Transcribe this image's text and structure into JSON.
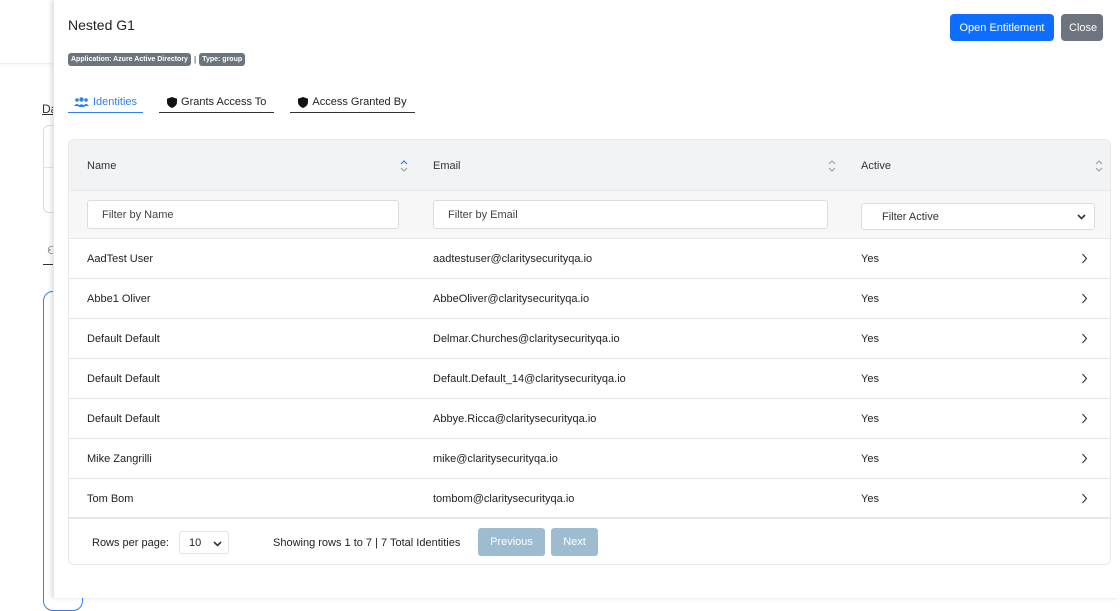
{
  "background": {
    "partial_link": "Da"
  },
  "modal": {
    "title": "Nested G1",
    "buttons": {
      "open_entitlement": "Open Entitlement",
      "close": "Close"
    },
    "badges": [
      "Application: Azure Active Directory",
      "Type: group"
    ],
    "badge_separator": "|",
    "tabs": [
      {
        "label": "Identities",
        "icon": "users-icon",
        "active": true
      },
      {
        "label": "Grants Access To",
        "icon": "shield-icon",
        "active": false
      },
      {
        "label": "Access Granted By",
        "icon": "shield-icon",
        "active": false
      }
    ],
    "accent_color": "#2f80ed"
  },
  "table": {
    "columns": [
      {
        "label": "Name",
        "sort": "ascending"
      },
      {
        "label": "Email",
        "sort": "none"
      },
      {
        "label": "Active",
        "sort": "none"
      }
    ],
    "filters": {
      "name_placeholder": "Filter by Name",
      "email_placeholder": "Filter by Email",
      "active_selected": "Filter Active"
    },
    "rows": [
      {
        "name": "AadTest User",
        "email": "aadtestuser@claritysecurityqa.io",
        "active": "Yes"
      },
      {
        "name": "Abbe1 Oliver",
        "email": "AbbeOliver@claritysecurityqa.io",
        "active": "Yes"
      },
      {
        "name": "Default Default",
        "email": "Delmar.Churches@claritysecurityqa.io",
        "active": "Yes"
      },
      {
        "name": "Default Default",
        "email": "Default.Default_14@claritysecurityqa.io",
        "active": "Yes"
      },
      {
        "name": "Default Default",
        "email": "Abbye.Ricca@claritysecurityqa.io",
        "active": "Yes"
      },
      {
        "name": "Mike Zangrilli",
        "email": "mike@claritysecurityqa.io",
        "active": "Yes"
      },
      {
        "name": "Tom Bom",
        "email": "tombom@claritysecurityqa.io",
        "active": "Yes"
      }
    ]
  },
  "pagination": {
    "rows_per_page_label": "Rows per page:",
    "rows_per_page_value": "10",
    "showing_text": "Showing rows 1 to 7 | 7 Total Identities",
    "previous_label": "Previous",
    "next_label": "Next"
  }
}
